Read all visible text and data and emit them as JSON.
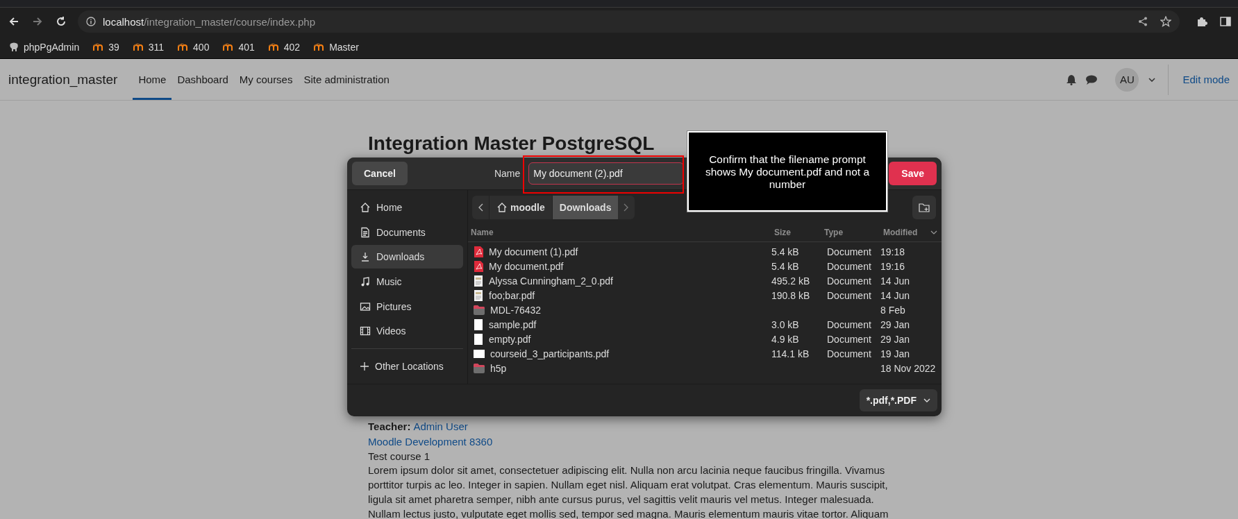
{
  "browser": {
    "address": {
      "host": "localhost",
      "path": "/integration_master/course/index.php"
    },
    "bookmarks": [
      {
        "kind": "elephant",
        "label": "phpPgAdmin"
      },
      {
        "kind": "moodle",
        "label": "39"
      },
      {
        "kind": "moodle",
        "label": "311"
      },
      {
        "kind": "moodle",
        "label": "400"
      },
      {
        "kind": "moodle",
        "label": "401"
      },
      {
        "kind": "moodle",
        "label": "402"
      },
      {
        "kind": "moodle",
        "label": "Master"
      }
    ]
  },
  "site": {
    "name": "integration_master",
    "nav": [
      {
        "label": "Home",
        "selected": true
      },
      {
        "label": "Dashboard",
        "selected": false
      },
      {
        "label": "My courses",
        "selected": false
      },
      {
        "label": "Site administration",
        "selected": false
      }
    ],
    "avatar": "AU",
    "edit_mode": "Edit mode"
  },
  "page": {
    "title": "Integration Master PostgreSQL",
    "teacher_label": "Teacher:",
    "teacher_name": "Admin User",
    "course_link": "Moodle Development 8360",
    "course_name": "Test course 1",
    "summary": "Lorem ipsum dolor sit amet, consectetuer adipiscing elit. Nulla non arcu lacinia neque faucibus fringilla. Vivamus porttitor turpis ac leo. Integer in sapien. Nullam eget nisl. Aliquam erat volutpat. Cras elementum. Mauris suscipit, ligula sit amet pharetra semper, nibh ante cursus purus, vel sagittis velit mauris vel metus. Integer malesuada. Nullam lectus justo, vulputate eget mollis sed, tempor sed magna. Mauris elementum mauris vitae tortor. Aliquam"
  },
  "dialog": {
    "cancel": "Cancel",
    "name_label": "Name",
    "filename": "My document (2).pdf",
    "save": "Save",
    "places": [
      {
        "kind": "home",
        "label": "Home",
        "selected": false
      },
      {
        "kind": "documents",
        "label": "Documents",
        "selected": false
      },
      {
        "kind": "downloads",
        "label": "Downloads",
        "selected": true
      },
      {
        "kind": "music",
        "label": "Music",
        "selected": false
      },
      {
        "kind": "pictures",
        "label": "Pictures",
        "selected": false
      },
      {
        "kind": "videos",
        "label": "Videos",
        "selected": false
      },
      {
        "kind": "other",
        "label": "Other Locations",
        "selected": false
      }
    ],
    "path": [
      {
        "kind": "home",
        "label": "moodle",
        "selected": false
      },
      {
        "kind": "folder",
        "label": "Downloads",
        "selected": true
      }
    ],
    "columns": [
      "Name",
      "Size",
      "Type",
      "Modified"
    ],
    "files": [
      {
        "kind": "pdf",
        "name": "My document (1).pdf",
        "size": "5.4 kB",
        "type": "Document",
        "modified": "19:18"
      },
      {
        "kind": "pdf",
        "name": "My document.pdf",
        "size": "5.4 kB",
        "type": "Document",
        "modified": "19:16"
      },
      {
        "kind": "thumbnail",
        "name": "Alyssa Cunningham_2_0.pdf",
        "size": "495.2 kB",
        "type": "Document",
        "modified": "14 Jun"
      },
      {
        "kind": "thumbnail",
        "name": "foo;bar.pdf",
        "size": "190.8 kB",
        "type": "Document",
        "modified": "14 Jun"
      },
      {
        "kind": "folder",
        "name": "MDL-76432",
        "modified": "8 Feb"
      },
      {
        "kind": "page",
        "name": "sample.pdf",
        "size": "3.0 kB",
        "type": "Document",
        "modified": "29 Jan"
      },
      {
        "kind": "page",
        "name": "empty.pdf",
        "size": "4.9 kB",
        "type": "Document",
        "modified": "29 Jan"
      },
      {
        "kind": "landscape",
        "name": "courseid_3_participants.pdf",
        "size": "114.1 kB",
        "type": "Document",
        "modified": "19 Jan"
      },
      {
        "kind": "folder",
        "name": "h5p",
        "modified": "18 Nov 2022"
      }
    ],
    "filter": "*.pdf,*.PDF"
  },
  "annotation": {
    "text": "Confirm that the filename prompt shows My document.pdf and not a number"
  }
}
